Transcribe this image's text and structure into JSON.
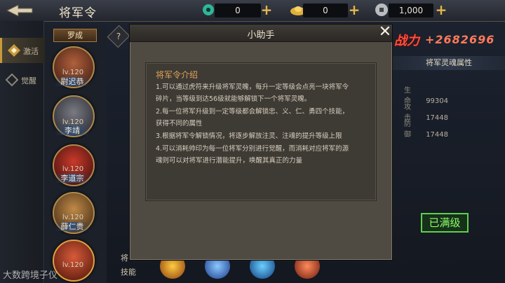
{
  "header": {
    "title": "将军令",
    "resources": [
      {
        "icon": "jade-icon",
        "value": "0"
      },
      {
        "icon": "gold-ingot-icon",
        "value": "0"
      },
      {
        "icon": "silver-coin-icon",
        "value": "1,000"
      }
    ]
  },
  "sidebar": {
    "tabs": [
      {
        "label": "激活",
        "active": true,
        "icon": "activate-icon"
      },
      {
        "label": "觉醒",
        "active": false,
        "icon": "awaken-icon"
      }
    ]
  },
  "hero_list": {
    "group_label": "罗成",
    "heroes": [
      {
        "level": "lv.120",
        "name": "尉迟恭"
      },
      {
        "level": "lv.120",
        "name": "李靖"
      },
      {
        "level": "lv.120",
        "name": "李道宗"
      },
      {
        "level": "lv.120",
        "name": "薛仁贵"
      },
      {
        "level": "lv.120",
        "name": ""
      }
    ]
  },
  "skills": {
    "label_top": "将",
    "label": "技能"
  },
  "stats": {
    "power_label": "战力",
    "power_value": "+2682696",
    "section_title": "将军灵魂属性",
    "attributes": [
      {
        "name": "生命",
        "value": "99304"
      },
      {
        "name": "攻击",
        "value": "17448"
      },
      {
        "name": "防御",
        "value": "17448"
      }
    ],
    "maxed_label": "已满级"
  },
  "modal": {
    "title": "小助手",
    "section_title": "将军令介绍",
    "lines": [
      "1.可以通过虎符来升级将军灵魄，每升一定等级会点亮一块将军令",
      "碎片，当等级到达56级就能够解锁下一个将军灵魄。",
      "2.每一位将军升级到一定等级都会解锁忠、义、仁、勇四个技能，",
      "获得不同的属性",
      "3.根据将军令解锁情况，将逐步解放注灵、注魂的提升等级上限",
      "4.可以消耗帅印为每一位将军分别进行觉醒，而消耗对应将军的源",
      "魂则可以对将军进行潜能提升，唤醒其真正的力量"
    ]
  },
  "watermark": "大数跨境子仪"
}
